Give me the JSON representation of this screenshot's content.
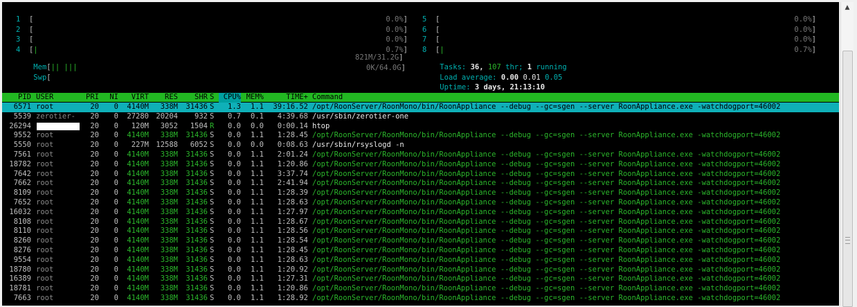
{
  "cpus_left": [
    {
      "num": "1",
      "bar": "",
      "pct": "0.0%"
    },
    {
      "num": "2",
      "bar": "",
      "pct": "0.0%"
    },
    {
      "num": "3",
      "bar": "",
      "pct": "0.0%"
    },
    {
      "num": "4",
      "bar": "|",
      "pct": "0.7%"
    }
  ],
  "cpus_right": [
    {
      "num": "5",
      "bar": "",
      "pct": "0.0%"
    },
    {
      "num": "6",
      "bar": "",
      "pct": "0.0%"
    },
    {
      "num": "7",
      "bar": "",
      "pct": "0.0%"
    },
    {
      "num": "8",
      "bar": "|",
      "pct": "0.7%"
    }
  ],
  "mem": {
    "label": "Mem",
    "bar": "|| |||",
    "value": "821M/31.2G"
  },
  "swp": {
    "label": "Swp",
    "bar": "",
    "value": "0K/64.0G"
  },
  "tasks": {
    "label": "Tasks:",
    "count": "36,",
    "thr": "107",
    "thr_label": "thr;",
    "running": "1",
    "running_label": "running"
  },
  "load": {
    "label": "Load average:",
    "v1": "0.00",
    "v2": "0.01",
    "v3": "0.05"
  },
  "uptime": {
    "label": "Uptime:",
    "value": "3 days, 21:13:10"
  },
  "columns": [
    "PID",
    "USER",
    "PRI",
    "NI",
    "VIRT",
    "RES",
    "SHR",
    "S",
    "CPU%",
    "MEM%",
    "TIME+",
    "Command"
  ],
  "processes": [
    {
      "pid": "6571",
      "user": "root",
      "pri": "20",
      "ni": "0",
      "virt": "4140M",
      "res": "338M",
      "shr": "31436",
      "s": "S",
      "cpu": "1.3",
      "mem": "1.1",
      "time": "39:16.52",
      "cmd": "/opt/RoonServer/RoonMono/bin/RoonAppliance --debug --gc=sgen --server RoonAppliance.exe -watchdogport=46002",
      "selected": true,
      "thread": true
    },
    {
      "pid": "5539",
      "user": "zerotier-",
      "pri": "20",
      "ni": "0",
      "virt": "27280",
      "res": "20204",
      "shr": "932",
      "s": "S",
      "cpu": "0.7",
      "mem": "0.1",
      "time": "4:39.68",
      "cmd": "/usr/sbin/zerotier-one",
      "thread": false
    },
    {
      "pid": "26294",
      "user": "",
      "pri": "20",
      "ni": "0",
      "virt": "120M",
      "res": "3052",
      "shr": "1504",
      "s": "R",
      "cpu": "0.0",
      "mem": "0.0",
      "time": "0:00.14",
      "cmd": "htop",
      "thread": false,
      "redacted": true
    },
    {
      "pid": "9552",
      "user": "root",
      "pri": "20",
      "ni": "0",
      "virt": "4140M",
      "res": "338M",
      "shr": "31436",
      "s": "S",
      "cpu": "0.0",
      "mem": "1.1",
      "time": "1:28.45",
      "cmd": "/opt/RoonServer/RoonMono/bin/RoonAppliance --debug --gc=sgen --server RoonAppliance.exe -watchdogport=46002",
      "thread": true
    },
    {
      "pid": "5550",
      "user": "root",
      "pri": "20",
      "ni": "0",
      "virt": "227M",
      "res": "12588",
      "shr": "6052",
      "s": "S",
      "cpu": "0.0",
      "mem": "0.0",
      "time": "0:08.63",
      "cmd": "/usr/sbin/rsyslogd -n",
      "thread": false
    },
    {
      "pid": "7561",
      "user": "root",
      "pri": "20",
      "ni": "0",
      "virt": "4140M",
      "res": "338M",
      "shr": "31436",
      "s": "S",
      "cpu": "0.0",
      "mem": "1.1",
      "time": "2:01.24",
      "cmd": "/opt/RoonServer/RoonMono/bin/RoonAppliance --debug --gc=sgen --server RoonAppliance.exe -watchdogport=46002",
      "thread": true
    },
    {
      "pid": "18782",
      "user": "root",
      "pri": "20",
      "ni": "0",
      "virt": "4140M",
      "res": "338M",
      "shr": "31436",
      "s": "S",
      "cpu": "0.0",
      "mem": "1.1",
      "time": "1:20.86",
      "cmd": "/opt/RoonServer/RoonMono/bin/RoonAppliance --debug --gc=sgen --server RoonAppliance.exe -watchdogport=46002",
      "thread": true
    },
    {
      "pid": "7642",
      "user": "root",
      "pri": "20",
      "ni": "0",
      "virt": "4140M",
      "res": "338M",
      "shr": "31436",
      "s": "S",
      "cpu": "0.0",
      "mem": "1.1",
      "time": "3:37.74",
      "cmd": "/opt/RoonServer/RoonMono/bin/RoonAppliance --debug --gc=sgen --server RoonAppliance.exe -watchdogport=46002",
      "thread": true
    },
    {
      "pid": "7662",
      "user": "root",
      "pri": "20",
      "ni": "0",
      "virt": "4140M",
      "res": "338M",
      "shr": "31436",
      "s": "S",
      "cpu": "0.0",
      "mem": "1.1",
      "time": "2:41.94",
      "cmd": "/opt/RoonServer/RoonMono/bin/RoonAppliance --debug --gc=sgen --server RoonAppliance.exe -watchdogport=46002",
      "thread": true
    },
    {
      "pid": "8109",
      "user": "root",
      "pri": "20",
      "ni": "0",
      "virt": "4140M",
      "res": "338M",
      "shr": "31436",
      "s": "S",
      "cpu": "0.0",
      "mem": "1.1",
      "time": "1:28.39",
      "cmd": "/opt/RoonServer/RoonMono/bin/RoonAppliance --debug --gc=sgen --server RoonAppliance.exe -watchdogport=46002",
      "thread": true
    },
    {
      "pid": "7652",
      "user": "root",
      "pri": "20",
      "ni": "0",
      "virt": "4140M",
      "res": "338M",
      "shr": "31436",
      "s": "S",
      "cpu": "0.0",
      "mem": "1.1",
      "time": "1:28.63",
      "cmd": "/opt/RoonServer/RoonMono/bin/RoonAppliance --debug --gc=sgen --server RoonAppliance.exe -watchdogport=46002",
      "thread": true
    },
    {
      "pid": "16032",
      "user": "root",
      "pri": "20",
      "ni": "0",
      "virt": "4140M",
      "res": "338M",
      "shr": "31436",
      "s": "S",
      "cpu": "0.0",
      "mem": "1.1",
      "time": "1:27.97",
      "cmd": "/opt/RoonServer/RoonMono/bin/RoonAppliance --debug --gc=sgen --server RoonAppliance.exe -watchdogport=46002",
      "thread": true
    },
    {
      "pid": "8108",
      "user": "root",
      "pri": "20",
      "ni": "0",
      "virt": "4140M",
      "res": "338M",
      "shr": "31436",
      "s": "S",
      "cpu": "0.0",
      "mem": "1.1",
      "time": "1:28.67",
      "cmd": "/opt/RoonServer/RoonMono/bin/RoonAppliance --debug --gc=sgen --server RoonAppliance.exe -watchdogport=46002",
      "thread": true
    },
    {
      "pid": "8110",
      "user": "root",
      "pri": "20",
      "ni": "0",
      "virt": "4140M",
      "res": "338M",
      "shr": "31436",
      "s": "S",
      "cpu": "0.0",
      "mem": "1.1",
      "time": "1:28.56",
      "cmd": "/opt/RoonServer/RoonMono/bin/RoonAppliance --debug --gc=sgen --server RoonAppliance.exe -watchdogport=46002",
      "thread": true
    },
    {
      "pid": "8260",
      "user": "root",
      "pri": "20",
      "ni": "0",
      "virt": "4140M",
      "res": "338M",
      "shr": "31436",
      "s": "S",
      "cpu": "0.0",
      "mem": "1.1",
      "time": "1:28.54",
      "cmd": "/opt/RoonServer/RoonMono/bin/RoonAppliance --debug --gc=sgen --server RoonAppliance.exe -watchdogport=46002",
      "thread": true
    },
    {
      "pid": "8276",
      "user": "root",
      "pri": "20",
      "ni": "0",
      "virt": "4140M",
      "res": "338M",
      "shr": "31436",
      "s": "S",
      "cpu": "0.0",
      "mem": "1.1",
      "time": "1:28.45",
      "cmd": "/opt/RoonServer/RoonMono/bin/RoonAppliance --debug --gc=sgen --server RoonAppliance.exe -watchdogport=46002",
      "thread": true
    },
    {
      "pid": "9554",
      "user": "root",
      "pri": "20",
      "ni": "0",
      "virt": "4140M",
      "res": "338M",
      "shr": "31436",
      "s": "S",
      "cpu": "0.0",
      "mem": "1.1",
      "time": "1:28.63",
      "cmd": "/opt/RoonServer/RoonMono/bin/RoonAppliance --debug --gc=sgen --server RoonAppliance.exe -watchdogport=46002",
      "thread": true
    },
    {
      "pid": "18780",
      "user": "root",
      "pri": "20",
      "ni": "0",
      "virt": "4140M",
      "res": "338M",
      "shr": "31436",
      "s": "S",
      "cpu": "0.0",
      "mem": "1.1",
      "time": "1:20.92",
      "cmd": "/opt/RoonServer/RoonMono/bin/RoonAppliance --debug --gc=sgen --server RoonAppliance.exe -watchdogport=46002",
      "thread": true
    },
    {
      "pid": "16389",
      "user": "root",
      "pri": "20",
      "ni": "0",
      "virt": "4140M",
      "res": "338M",
      "shr": "31436",
      "s": "S",
      "cpu": "0.0",
      "mem": "1.1",
      "time": "1:27.31",
      "cmd": "/opt/RoonServer/RoonMono/bin/RoonAppliance --debug --gc=sgen --server RoonAppliance.exe -watchdogport=46002",
      "thread": true
    },
    {
      "pid": "18781",
      "user": "root",
      "pri": "20",
      "ni": "0",
      "virt": "4140M",
      "res": "338M",
      "shr": "31436",
      "s": "S",
      "cpu": "0.0",
      "mem": "1.1",
      "time": "1:20.86",
      "cmd": "/opt/RoonServer/RoonMono/bin/RoonAppliance --debug --gc=sgen --server RoonAppliance.exe -watchdogport=46002",
      "thread": true
    },
    {
      "pid": "7663",
      "user": "root",
      "pri": "20",
      "ni": "0",
      "virt": "4140M",
      "res": "338M",
      "shr": "31436",
      "s": "S",
      "cpu": "0.0",
      "mem": "1.1",
      "time": "1:28.92",
      "cmd": "/opt/RoonServer/RoonMono/bin/RoonAppliance --debug --gc=sgen --server RoonAppliance.exe -watchdogport=46002",
      "thread": true
    }
  ],
  "scrollbar": {
    "up_icon": "triangle-up",
    "down_icon": "triangle-down"
  }
}
